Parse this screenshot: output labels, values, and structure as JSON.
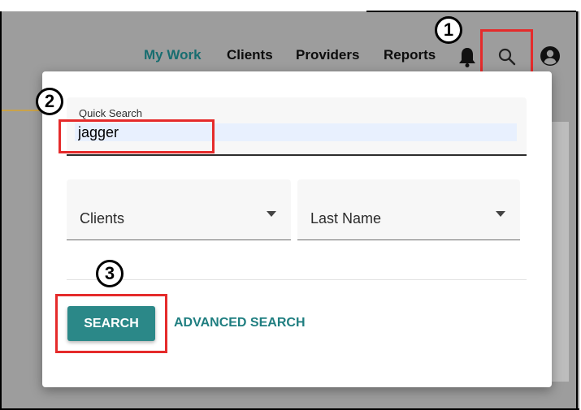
{
  "nav": {
    "items": [
      {
        "label": "My Work"
      },
      {
        "label": "Clients"
      },
      {
        "label": "Providers"
      },
      {
        "label": "Reports"
      }
    ],
    "notification_icon": "bell-icon",
    "search_icon": "search-icon",
    "account_icon": "account-circle-icon"
  },
  "quick_search": {
    "label": "Quick Search",
    "value": "jagger",
    "category_select": {
      "value": "Clients"
    },
    "field_select": {
      "value": "Last Name"
    },
    "search_button": "SEARCH",
    "advanced_link": "ADVANCED SEARCH"
  },
  "annotations": {
    "step1": "1",
    "step2": "2",
    "step3": "3"
  },
  "colors": {
    "accent": "#2b8888",
    "active_nav": "#176d70",
    "callout": "#e52b2b"
  }
}
